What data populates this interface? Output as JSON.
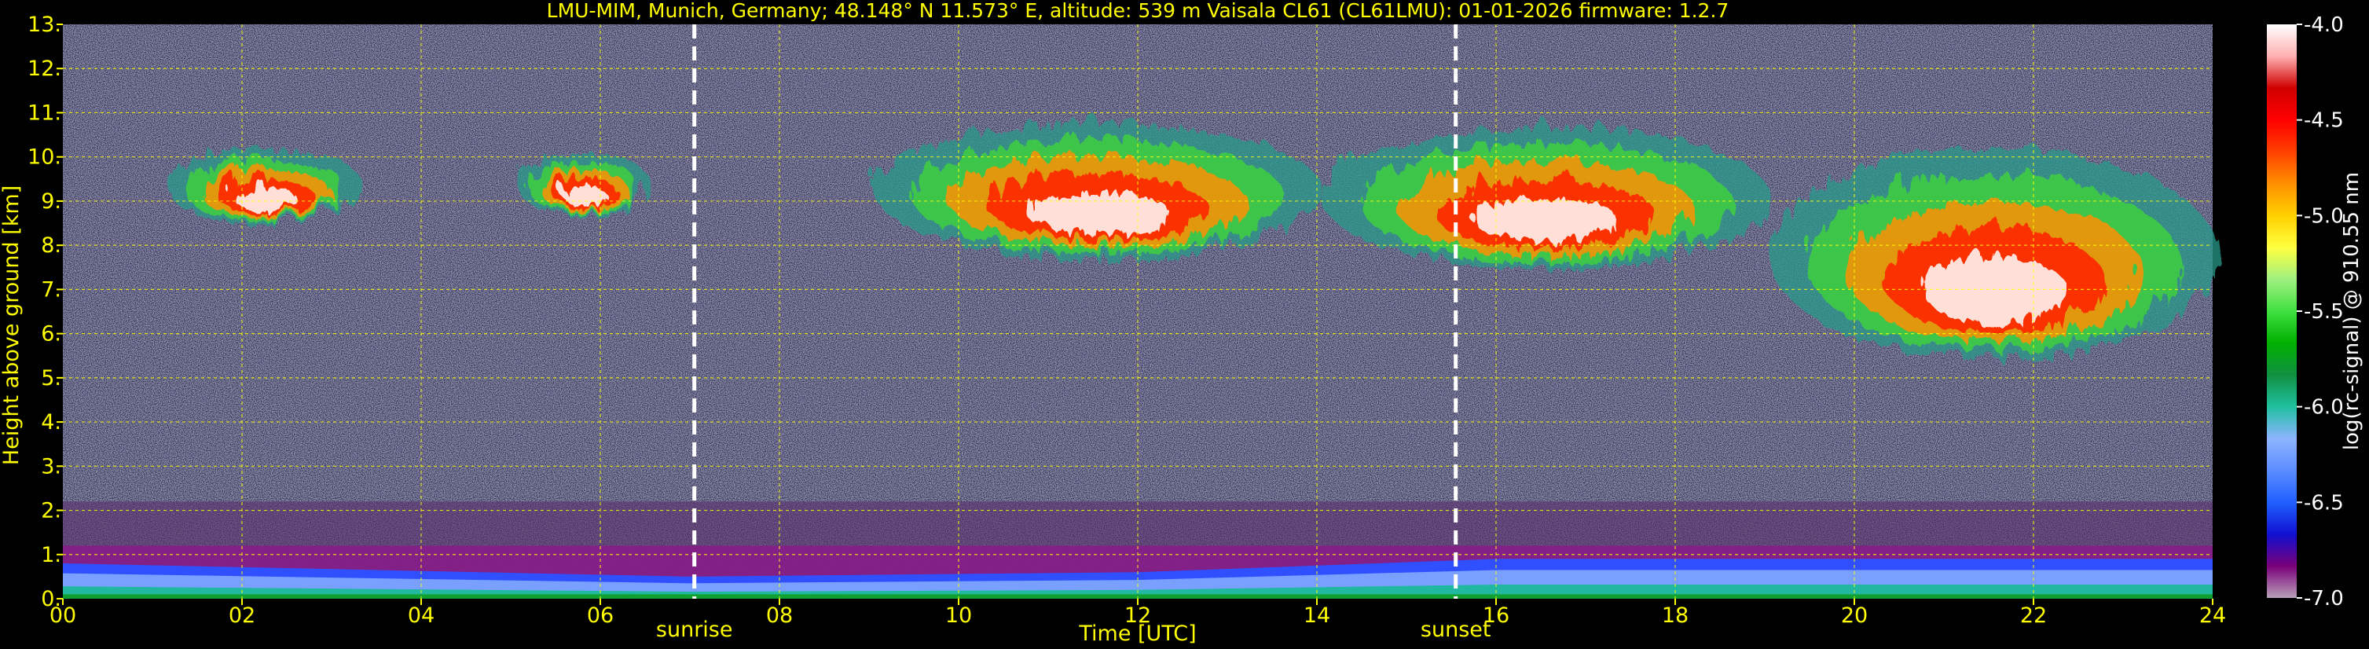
{
  "chart_data": {
    "type": "heatmap",
    "title": "LMU-MIM, Munich, Germany; 48.148° N 11.573° E, altitude: 539 m    Vaisala CL61 (CL61LMU): 01-01-2026    firmware: 1.2.7",
    "xlabel": "Time [UTC]",
    "ylabel": "Height above ground [km]",
    "xlim": [
      0,
      24
    ],
    "ylim": [
      0,
      13
    ],
    "x_ticks": [
      "00",
      "02",
      "04",
      "06",
      "08",
      "10",
      "12",
      "14",
      "16",
      "18",
      "20",
      "22",
      "24"
    ],
    "y_ticks": [
      "0.",
      "1.",
      "2.",
      "3.",
      "4.",
      "5.",
      "6.",
      "7.",
      "8.",
      "9.",
      "10.",
      "11.",
      "12.",
      "13."
    ],
    "grid": true,
    "colorbar": {
      "label": "log(rc-signal) @ 910.55 nm",
      "range": [
        -7.0,
        -4.0
      ],
      "ticks": [
        "-4.0",
        "-4.5",
        "-5.0",
        "-5.5",
        "-6.0",
        "-6.5",
        "-7.0"
      ],
      "colors": [
        "#b8a0b8",
        "#7a007a",
        "#1010d0",
        "#2060ff",
        "#5b8cff",
        "#8cb4ff",
        "#20c0a0",
        "#109040",
        "#00b000",
        "#40e040",
        "#a0f080",
        "#ffff40",
        "#ffd000",
        "#ff9000",
        "#ff4000",
        "#ff0000",
        "#d00000",
        "#ffb0b0",
        "#ffffff"
      ]
    },
    "events": [
      {
        "label": "sunrise",
        "time": 7.05
      },
      {
        "label": "sunset",
        "time": 15.55
      }
    ],
    "cloud_layers": [
      {
        "time_start": 1.1,
        "time_end": 3.3,
        "base_km": 8.6,
        "top_km": 10.3
      },
      {
        "time_start": 5.0,
        "time_end": 6.5,
        "base_km": 8.8,
        "top_km": 10.2
      },
      {
        "time_start": 9.0,
        "time_end": 14.0,
        "base_km": 7.8,
        "top_km": 10.9
      },
      {
        "time_start": 14.0,
        "time_end": 19.0,
        "base_km": 7.6,
        "top_km": 10.8
      },
      {
        "time_start": 19.0,
        "time_end": 24.0,
        "base_km": 5.5,
        "top_km": 10.3
      }
    ],
    "boundary_layer_top_km": [
      {
        "time": 0,
        "height": 0.7
      },
      {
        "time": 7,
        "height": 0.4
      },
      {
        "time": 12,
        "height": 0.5
      },
      {
        "time": 16,
        "height": 0.8
      },
      {
        "time": 24,
        "height": 0.8
      }
    ]
  }
}
